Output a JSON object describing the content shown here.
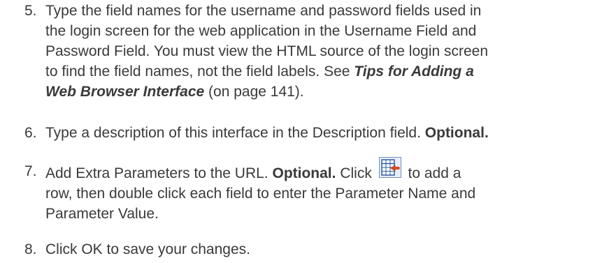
{
  "steps": [
    {
      "number": "5.",
      "lines": [
        "Type the field names for the username and password fields used in",
        "the login screen for the web application in the Username Field and",
        "Password Field. You must view the HTML source of the login screen",
        "to find the field names, not the field labels. See "
      ],
      "xref_part1": "Tips for Adding a",
      "xref_part2": "Web Browser Interface",
      "after_xref": " (on page 141)."
    },
    {
      "number": "6.",
      "text": "Type a description of this interface in the Description field. ",
      "bold": "Optional."
    },
    {
      "number": "7.",
      "text_before": "Add Extra Parameters to the URL. ",
      "bold": "Optional.",
      "text_click": " Click ",
      "icon": "add-row-icon",
      "text_after": " to add a",
      "line2": "row, then double click each field to enter the Parameter Name and",
      "line3": "Parameter Value."
    },
    {
      "number": "8.",
      "text": "Click OK to save your changes."
    }
  ]
}
